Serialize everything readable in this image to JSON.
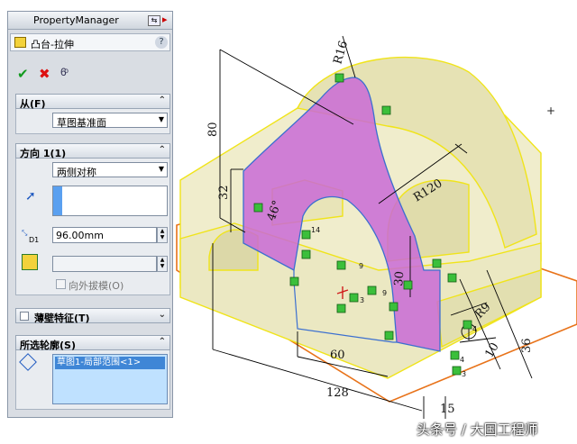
{
  "panel": {
    "title": "PropertyManager",
    "feature_name": "凸台-拉伸",
    "help_label": "?",
    "from_group": {
      "label": "从(F)",
      "start_value": "草图基准面"
    },
    "direction_group": {
      "label": "方向 1(1)",
      "end_condition": "两侧对称",
      "depth_value": "96.00mm",
      "depth_unit_label": "D1",
      "draft_label": "向外拔模(O)",
      "draft_checked": false
    },
    "thin_feature": {
      "label": "薄壁特征(T)",
      "checked": false
    },
    "selected_contours": {
      "label": "所选轮廓(S)",
      "items": [
        "草图1-局部范围<1>"
      ]
    }
  },
  "dimensions": {
    "r16": "R16",
    "d80": "80",
    "d32": "32",
    "d46": "46°",
    "r120": "R120",
    "d14": "14",
    "d30": "30",
    "d60": "60",
    "d128": "128",
    "d15": "15",
    "r9": "R9",
    "d10": "10",
    "d36": "36"
  },
  "relation_labels": [
    "14",
    "9",
    "9",
    "4",
    "3",
    "4",
    "3"
  ],
  "watermark": "头条号 / 大国工程师",
  "colors": {
    "model_face": "#ece9c6",
    "model_edge": "#f0e41a",
    "sketch_fill": "#c96ad6",
    "plane": "#e8731a",
    "relation_green": "#3bbf3b"
  }
}
